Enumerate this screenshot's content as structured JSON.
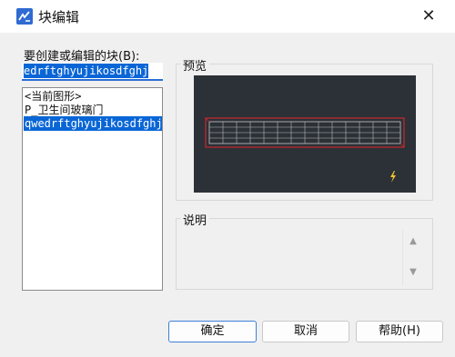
{
  "window": {
    "title": "块编辑",
    "close_glyph": "✕"
  },
  "prompt_label": "要创建或编辑的块(B):",
  "block_name_input": {
    "value": "edrftghyujikosdfghj"
  },
  "block_list": [
    {
      "label": "<当前图形>",
      "selected": false
    },
    {
      "label": "P_卫生间玻璃门",
      "selected": false
    },
    {
      "label": "qwedrftghyujikosdfghj",
      "selected": true
    }
  ],
  "preview": {
    "label": "预览",
    "background": "#2b3137",
    "outline_color": "#c8282c",
    "grid_color": "#c8c8c8",
    "marker_color": "#f2c230",
    "marker_icon": "lightning-bolt-icon"
  },
  "description": {
    "label": "说明",
    "scroll_up": "▲",
    "scroll_down": "▼"
  },
  "buttons": {
    "ok": "确定",
    "cancel": "取消",
    "help": "帮助(H)"
  },
  "colors": {
    "accent": "#0a66d6",
    "dialog_bg": "#f0f0f0"
  }
}
